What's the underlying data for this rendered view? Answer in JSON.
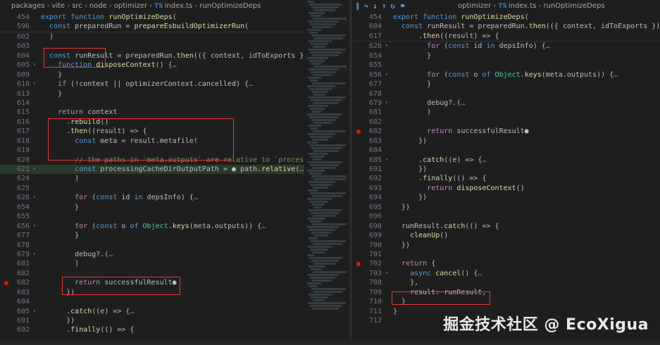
{
  "left": {
    "breadcrumb": [
      "packages",
      "vite",
      "src",
      "node",
      "optimizer",
      "index.ts",
      "runOptimizeDeps"
    ],
    "sticky": [
      {
        "num": "454",
        "text": "export function runOptimizeDeps("
      },
      {
        "num": "596",
        "text": "  const preparedRun = prepareEsbuildOptimizerRun("
      }
    ],
    "lines": [
      {
        "num": "602",
        "text": "  )"
      },
      {
        "num": "603",
        "text": ""
      },
      {
        "num": "604",
        "text": "  const runResult = preparedRun.then(({ context, idToExports }) => {"
      },
      {
        "num": "605",
        "text": "    function disposeContext() {…",
        "fold": ">"
      },
      {
        "num": "609",
        "text": "    }"
      },
      {
        "num": "610",
        "text": "    if (!context || optimizerContext.cancelled) {…",
        "fold": ">"
      },
      {
        "num": "613",
        "text": "    }"
      },
      {
        "num": "614",
        "text": ""
      },
      {
        "num": "615",
        "text": "    return context"
      },
      {
        "num": "616",
        "text": "      .rebuild()"
      },
      {
        "num": "617",
        "text": "      .then((result) => {"
      },
      {
        "num": "618",
        "text": "        const meta = result.metafile!"
      },
      {
        "num": "619",
        "text": ""
      },
      {
        "num": "620",
        "text": "        // the paths in `meta.outputs` are relative to `process.cwd()"
      },
      {
        "num": "621",
        "text": "        const processingCacheDirOutputPath = ● path.relative(…",
        "fold": ">",
        "hl": true
      },
      {
        "num": "624",
        "text": "        )"
      },
      {
        "num": "625",
        "text": ""
      },
      {
        "num": "626",
        "text": "        for (const id in depsInfo) {…",
        "fold": ">"
      },
      {
        "num": "654",
        "text": "        }"
      },
      {
        "num": "655",
        "text": ""
      },
      {
        "num": "656",
        "text": "        for (const o of Object.keys(meta.outputs)) {…",
        "fold": ">"
      },
      {
        "num": "677",
        "text": "        }"
      },
      {
        "num": "678",
        "text": ""
      },
      {
        "num": "679",
        "text": "        debug?.(…",
        "fold": ">"
      },
      {
        "num": "681",
        "text": "        )"
      },
      {
        "num": "682",
        "text": ""
      },
      {
        "num": "682",
        "text": "        return successfulResult●",
        "bp": true
      },
      {
        "num": "683",
        "text": "      })"
      },
      {
        "num": "684",
        "text": ""
      },
      {
        "num": "685",
        "text": "      .catch((e) => {…",
        "fold": ">"
      },
      {
        "num": "691",
        "text": "      })"
      },
      {
        "num": "692",
        "text": "      .finally(() => {"
      }
    ]
  },
  "right": {
    "breadcrumb": [
      "optimizer",
      "index.ts",
      "runOptimizeDeps"
    ],
    "sticky": [
      {
        "num": "454",
        "text": "export function runOptimizeDeps("
      },
      {
        "num": "604",
        "text": "  const runResult = preparedRun.then(({ context, idToExports }) => {"
      },
      {
        "num": "617",
        "text": "      .then((result) => {"
      }
    ],
    "lines": [
      {
        "num": "626",
        "text": "        for (const id in depsInfo) {…",
        "fold": ">"
      },
      {
        "num": "654",
        "text": "        }"
      },
      {
        "num": "655",
        "text": ""
      },
      {
        "num": "656",
        "text": "        for (const o of Object.keys(meta.outputs)) {…",
        "fold": ">"
      },
      {
        "num": "677",
        "text": "        }"
      },
      {
        "num": "678",
        "text": ""
      },
      {
        "num": "679",
        "text": "        debug?.(…",
        "fold": ">"
      },
      {
        "num": "681",
        "text": "        )"
      },
      {
        "num": "682",
        "text": ""
      },
      {
        "num": "682",
        "text": "        return successfulResult●",
        "bp": true
      },
      {
        "num": "683",
        "text": "      })"
      },
      {
        "num": "684",
        "text": ""
      },
      {
        "num": "685",
        "text": "      .catch((e) => {…",
        "fold": ">"
      },
      {
        "num": "691",
        "text": "      })"
      },
      {
        "num": "692",
        "text": "      .finally(() => {"
      },
      {
        "num": "693",
        "text": "        return disposeContext()"
      },
      {
        "num": "694",
        "text": "      })"
      },
      {
        "num": "695",
        "text": "  })"
      },
      {
        "num": "696",
        "text": ""
      },
      {
        "num": "698",
        "text": "  runResult.catch(() => {"
      },
      {
        "num": "699",
        "text": "    cleanUp()"
      },
      {
        "num": "700",
        "text": "  })"
      },
      {
        "num": "701",
        "text": ""
      },
      {
        "num": "702",
        "text": "  return {",
        "bp": true
      },
      {
        "num": "703",
        "text": "    async cancel() {…",
        "fold": ">"
      },
      {
        "num": "708",
        "text": "    },"
      },
      {
        "num": "709",
        "text": "    result: runResult,"
      },
      {
        "num": "710",
        "text": "  }"
      },
      {
        "num": "711",
        "text": "}"
      },
      {
        "num": "712",
        "text": ""
      }
    ]
  },
  "debug_toolbar": [
    "pause-icon",
    "step-over-icon",
    "step-into-icon",
    "step-out-icon",
    "restart-icon",
    "disconnect-icon"
  ],
  "watermark": "掘金技术社区 @ EcoXigua"
}
